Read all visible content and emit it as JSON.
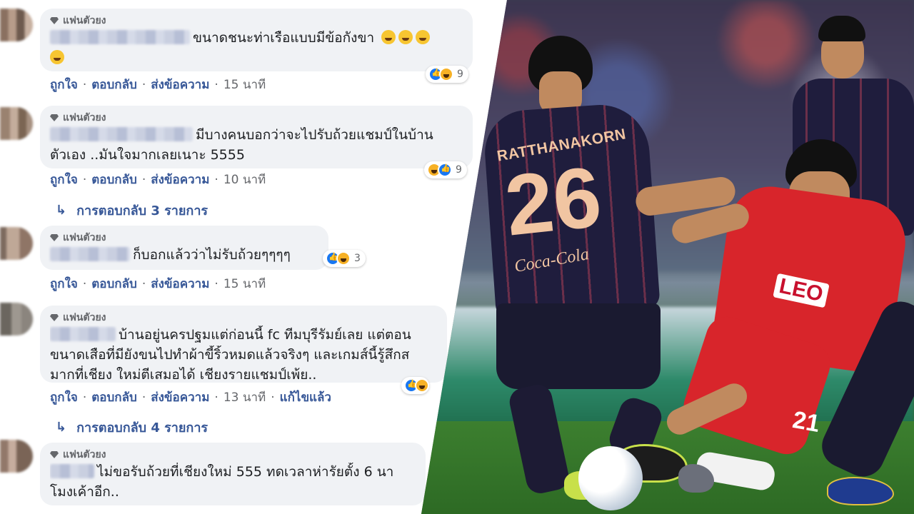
{
  "comments": [
    {
      "badge": "แฟนตัวยง",
      "lines": [
        "ขนาดชนะท่าเรือแบบมีข้อกังขา"
      ],
      "reaction_count": "9",
      "actions": {
        "like": "ถูกใจ",
        "reply": "ตอบกลับ",
        "message": "ส่งข้อความ",
        "time": "15 นาที"
      }
    },
    {
      "badge": "แฟนตัวยง",
      "lines": [
        "มีบางคนบอกว่าจะไปรับถ้วยแชมป์ในบ้าน",
        "ตัวเอง ..มันใจมากเลยเนาะ 5555"
      ],
      "reaction_count": "9",
      "actions": {
        "like": "ถูกใจ",
        "reply": "ตอบกลับ",
        "message": "ส่งข้อความ",
        "time": "10 นาที"
      },
      "replies_link": "การตอบกลับ 3 รายการ"
    },
    {
      "badge": "แฟนตัวยง",
      "lines": [
        "ก็บอกแล้วว่าไม่รับถ้วยๆๆๆๆ"
      ],
      "reaction_count": "3",
      "actions": {
        "like": "ถูกใจ",
        "reply": "ตอบกลับ",
        "message": "ส่งข้อความ",
        "time": "15 นาที"
      }
    },
    {
      "badge": "แฟนตัวยง",
      "lines": [
        "บ้านอยู่นครปฐมแต่ก่อนนี้ fc ทีมบุรีรัมย์เลย แต่ตอน",
        "ขนาดเสือที่มียังขนไปทำผ้าขี้ริ้วหมดแล้วจริงๆ และเกมส์นี้รู้สึกส",
        "มากที่เชียง ใหม่ตีเสมอได้ เชียงรายแชมป์เพ้ย.."
      ],
      "actions": {
        "like": "ถูกใจ",
        "reply": "ตอบกลับ",
        "message": "ส่งข้อความ",
        "time": "13 นาที",
        "edited": "แก้ไขแล้ว"
      },
      "replies_link": "การตอบกลับ 4 รายการ"
    },
    {
      "badge": "แฟนตัวยง",
      "lines": [
        "ไม่ขอรับถ้วยที่เชียงใหม่ 555 ทดเวลาห่ารัยตั้ง 6 นา",
        "โมงเค้าอีก.."
      ]
    }
  ],
  "photo": {
    "player_back_name": "RATTHANAKORN",
    "player_back_number": "26",
    "player_back_sponsor": "Coca-Cola",
    "red_player_sponsor": "LEO",
    "red_player_number": "21"
  }
}
